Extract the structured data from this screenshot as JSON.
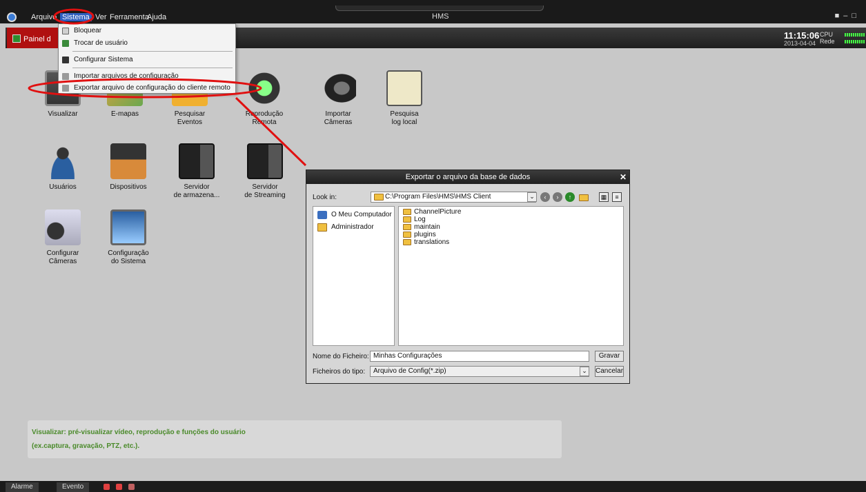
{
  "menubar": {
    "items": [
      "Arquivo",
      "Sistema",
      "Ver",
      "Ferramenta",
      "Ajuda"
    ],
    "active": "Sistema"
  },
  "app_title": "HMS",
  "painel_label": "Painel d",
  "clock": {
    "time": "11:15:06",
    "date": "2013-04-04"
  },
  "stats": {
    "cpu_label": "CPU",
    "net_label": "Rede"
  },
  "system_menu": {
    "items": [
      {
        "label": "Bloquear",
        "icon": "lock-icon"
      },
      {
        "label": "Trocar de usuário",
        "icon": "switch-user-icon"
      },
      {
        "label": "Configurar Sistema",
        "icon": "settings-icon"
      },
      {
        "label": "Importar arquivos de configuração",
        "icon": "import-icon"
      },
      {
        "label": "Exportar arquivo de configuração do cliente remoto",
        "icon": "export-icon"
      }
    ]
  },
  "tiles": [
    {
      "label1": "Visualizar",
      "label2": "",
      "icon": "monitor-icon"
    },
    {
      "label1": "E-mapas",
      "label2": "",
      "icon": "map-icon"
    },
    {
      "label1": "Pesquisar",
      "label2": "Eventos",
      "icon": "event-folder-icon"
    },
    {
      "label1": "Reprodução",
      "label2": "Remota",
      "icon": "playback-icon"
    },
    {
      "label1": "Importar",
      "label2": "Câmeras",
      "icon": "camera-icon"
    },
    {
      "label1": "Pesquisa",
      "label2": "log local",
      "icon": "log-clipboard-icon"
    },
    {
      "label1": "Usuários",
      "label2": "",
      "icon": "user-icon"
    },
    {
      "label1": "Dispositivos",
      "label2": "",
      "icon": "device-icon"
    },
    {
      "label1": "Servidor",
      "label2": "de armazena...",
      "icon": "storage-server-icon"
    },
    {
      "label1": "Servidor",
      "label2": "de Streaming",
      "icon": "streaming-server-icon"
    },
    {
      "label1": "Configurar",
      "label2": "Câmeras",
      "icon": "camera-config-icon"
    },
    {
      "label1": "Configuração",
      "label2": "do Sistema",
      "icon": "system-config-icon"
    }
  ],
  "description": {
    "line1": "Visualizar: pré-visualizar vídeo, reprodução e funções do usuário",
    "line2": "(ex.captura, gravação, PTZ, etc.)."
  },
  "bottom": {
    "alarm": "Alarme",
    "event": "Evento"
  },
  "dialog": {
    "title": "Exportar o arquivo da base de dados",
    "look_in_label": "Look in:",
    "look_in_path": "C:\\Program Files\\HMS\\HMS Client",
    "places": [
      "O Meu Computador",
      "Administrador"
    ],
    "files": [
      "ChannelPicture",
      "Log",
      "maintain",
      "plugins",
      "translations"
    ],
    "filename_label": "Nome do Ficheiro:",
    "filename_value": "Minhas Configurações",
    "filetype_label": "Ficheiros do tipo:",
    "filetype_value": "Arquivo de Config(*.zip)",
    "save_label": "Gravar",
    "cancel_label": "Cancelar"
  }
}
